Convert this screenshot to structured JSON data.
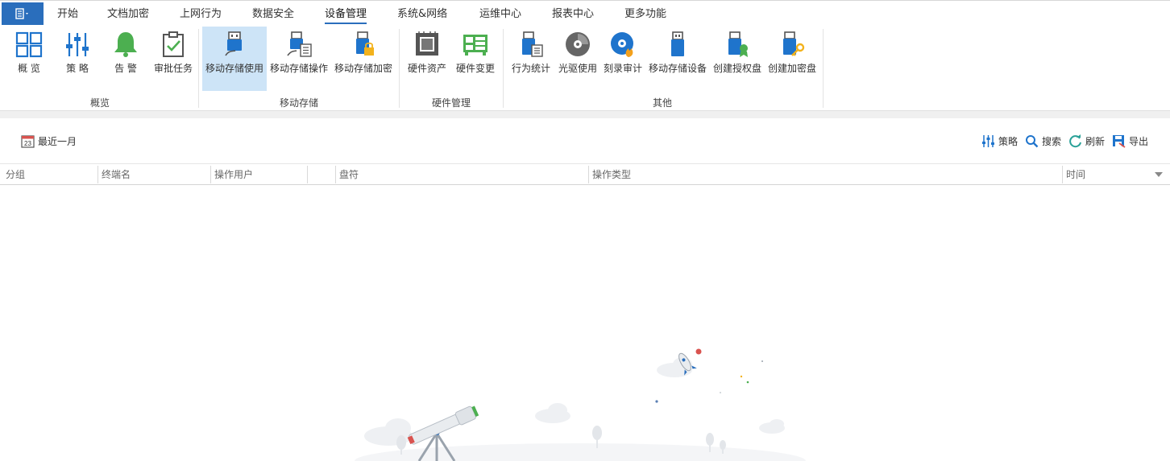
{
  "menu": {
    "tabs": [
      {
        "label": "开始"
      },
      {
        "label": "文档加密"
      },
      {
        "label": "上网行为"
      },
      {
        "label": "数据安全"
      },
      {
        "label": "设备管理"
      },
      {
        "label": "系统&网络"
      },
      {
        "label": "运维中心"
      },
      {
        "label": "报表中心"
      },
      {
        "label": "更多功能"
      }
    ],
    "active": "设备管理"
  },
  "ribbon": {
    "groups": [
      {
        "title": "概览",
        "buttons": [
          {
            "label": "概 览",
            "icon": "grid-icon"
          },
          {
            "label": "策 略",
            "icon": "sliders-icon"
          },
          {
            "label": "告 警",
            "icon": "bell-icon"
          },
          {
            "label": "审批任务",
            "icon": "clipboard-check-icon"
          }
        ]
      },
      {
        "title": "移动存储",
        "buttons": [
          {
            "label": "移动存储使用",
            "icon": "usb-drive-icon",
            "selected": true
          },
          {
            "label": "移动存储操作",
            "icon": "usb-list-icon"
          },
          {
            "label": "移动存储加密",
            "icon": "usb-lock-icon"
          }
        ]
      },
      {
        "title": "硬件管理",
        "buttons": [
          {
            "label": "硬件资产",
            "icon": "cpu-icon"
          },
          {
            "label": "硬件变更",
            "icon": "board-icon"
          }
        ]
      },
      {
        "title": "其他",
        "buttons": [
          {
            "label": "行为统计",
            "icon": "usb-stats-icon"
          },
          {
            "label": "光驱使用",
            "icon": "disc-icon"
          },
          {
            "label": "刻录审计",
            "icon": "burn-disc-icon"
          },
          {
            "label": "移动存储设备",
            "icon": "usb-device-icon"
          },
          {
            "label": "创建授权盘",
            "icon": "usb-badge-icon"
          },
          {
            "label": "创建加密盘",
            "icon": "usb-key-icon"
          }
        ]
      }
    ]
  },
  "toolbar": {
    "date_range": "最近一月",
    "calendar_day": "23",
    "actions": [
      {
        "label": "策略",
        "icon": "sliders-icon"
      },
      {
        "label": "搜索",
        "icon": "search-icon"
      },
      {
        "label": "刷新",
        "icon": "refresh-icon"
      },
      {
        "label": "导出",
        "icon": "export-icon"
      }
    ]
  },
  "grid": {
    "columns": [
      "分组",
      "终端名",
      "操作用户",
      "",
      "盘符",
      "操作类型",
      "时间"
    ]
  },
  "colors": {
    "accent": "#2a6ebc",
    "selected_bg": "#cde4f7",
    "icon_blue": "#1f74cc",
    "icon_green": "#4caf50"
  }
}
